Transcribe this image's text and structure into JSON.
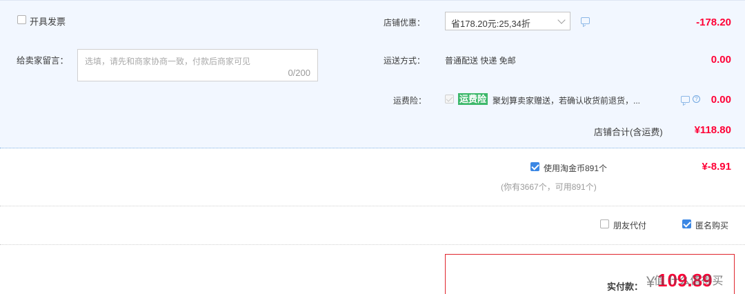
{
  "invoice": {
    "label": "开具发票",
    "checked": false
  },
  "message": {
    "label": "给卖家留言：",
    "placeholder": "选填，请先和商家协商一致，付款后商家可见",
    "counter": "0/200"
  },
  "shop_discount": {
    "label": "店铺优惠：",
    "selected": "省178.20元:25,34折",
    "amount": "-178.20"
  },
  "shipping": {
    "label": "运送方式：",
    "value": "普通配送 快递 免邮",
    "amount": "0.00"
  },
  "shipping_insurance": {
    "label": "运费险：",
    "badge": "运费险",
    "description": "聚划算卖家赠送，若确认收货前退货，...",
    "amount": "0.00"
  },
  "shop_total": {
    "label": "店铺合计(含运费)",
    "amount": "¥118.80"
  },
  "taobao_coins": {
    "label": "使用淘金币891个",
    "note": "(你有3667个，可用891个)",
    "amount": "¥-8.91",
    "checked": true
  },
  "options": {
    "friend_pay": {
      "label": "朋友代付",
      "checked": false
    },
    "anonymous": {
      "label": "匿名购买",
      "checked": true
    }
  },
  "actual_payment": {
    "label": "实付款：",
    "currency": "¥",
    "amount": "109.89"
  },
  "watermark": "值 什么值得买",
  "colors": {
    "accent_red": "#ff0036",
    "accent_blue": "#3b87e4",
    "panel_bg": "#f2f7ff",
    "insurance_green": "#3db86b"
  }
}
